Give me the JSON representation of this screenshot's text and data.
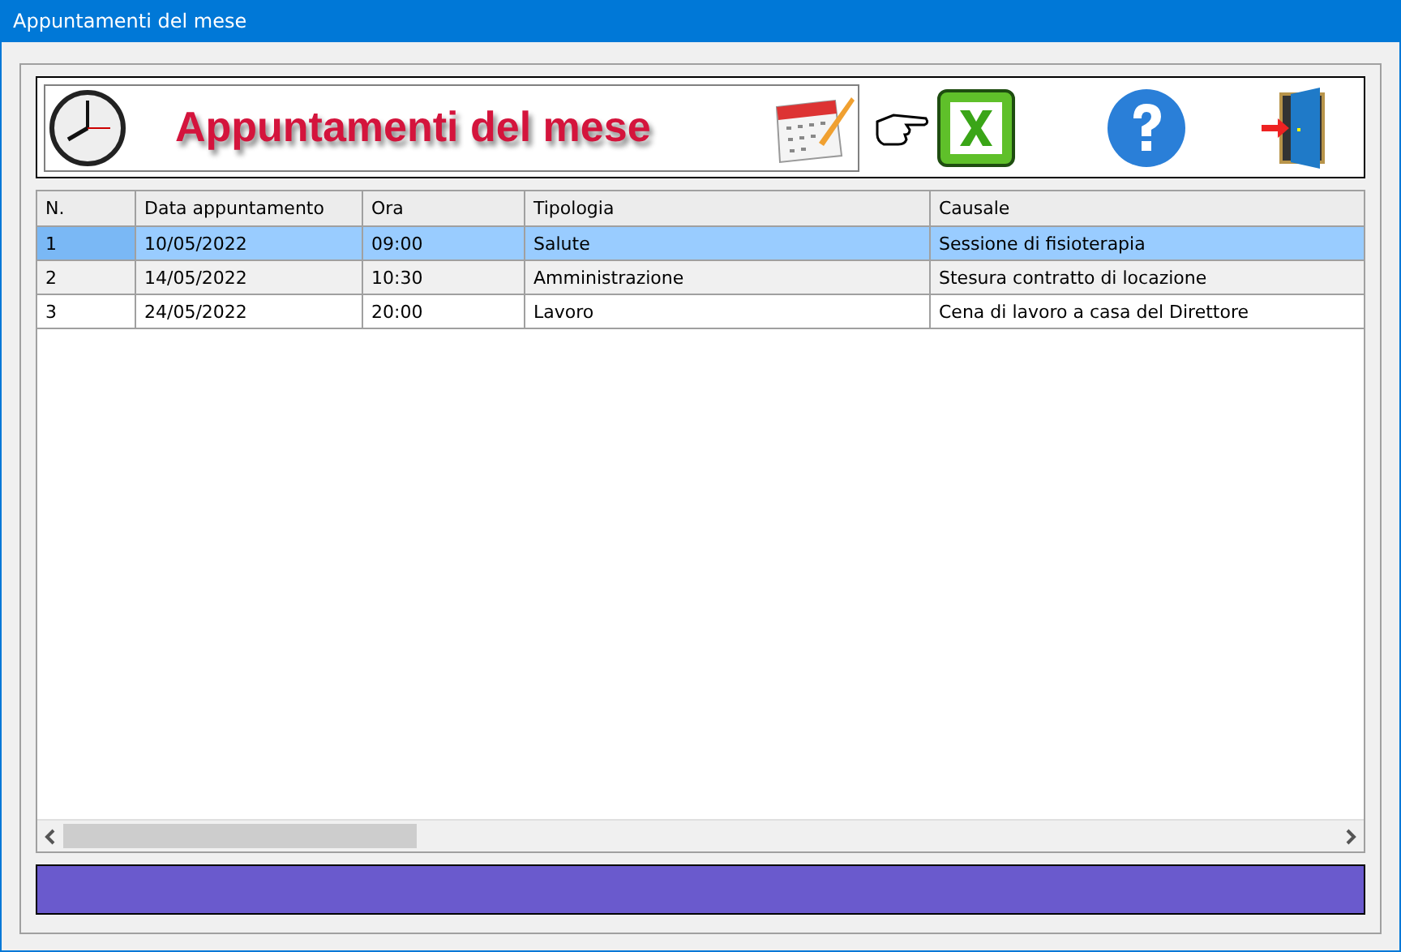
{
  "window": {
    "title": "Appuntamenti del mese"
  },
  "banner": {
    "title": "Appuntamenti del mese"
  },
  "table": {
    "columns": [
      "N.",
      "Data appuntamento",
      "Ora",
      "Tipologia",
      "Causale"
    ],
    "rows": [
      {
        "cells": [
          "1",
          "10/05/2022",
          "09:00",
          "Salute",
          "Sessione di fisioterapia"
        ],
        "selected": true
      },
      {
        "cells": [
          "2",
          "14/05/2022",
          "10:30",
          "Amministrazione",
          "Stesura contratto di locazione"
        ],
        "selected": false
      },
      {
        "cells": [
          "3",
          "24/05/2022",
          "20:00",
          "Lavoro",
          "Cena di lavoro a casa del Direttore"
        ],
        "selected": false
      }
    ]
  }
}
